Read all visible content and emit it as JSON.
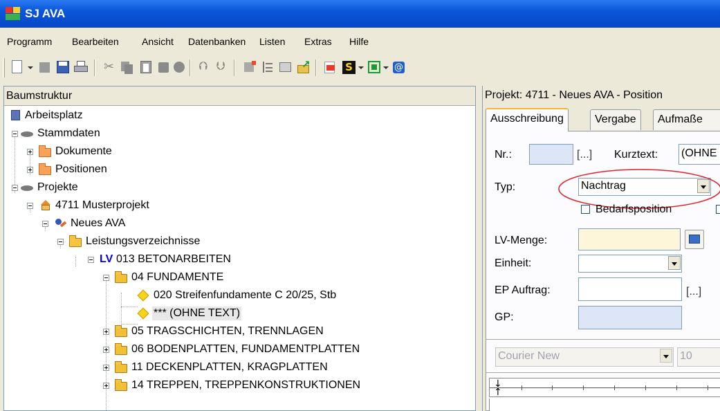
{
  "window": {
    "title": "SJ AVA"
  },
  "menu": [
    "Programm",
    "Bearbeiten",
    "Ansicht",
    "Datenbanken",
    "Listen",
    "Extras",
    "Hilfe"
  ],
  "left_pane": {
    "header": "Baumstruktur",
    "tree": {
      "arbeitsplatz": "Arbeitsplatz",
      "stammdaten": "Stammdaten",
      "dokumente": "Dokumente",
      "positionen": "Positionen",
      "projekte": "Projekte",
      "musterprojekt": "4711 Musterprojekt",
      "neues_ava": "Neues AVA",
      "lv_verzeichnisse": "Leistungsverzeichnisse",
      "lv_tag": "LV",
      "lv_013": "013 BETONARBEITEN",
      "f04": "04 FUNDAMENTE",
      "p020": "020 Streifenfundamente C 20/25, Stb",
      "ohne_text": "*** (OHNE TEXT)",
      "f05": "05 TRAGSCHICHTEN, TRENNLAGEN",
      "f06": "06 BODENPLATTEN, FUNDAMENTPLATTEN",
      "f11": "11 DECKENPLATTEN, KRAGPLATTEN",
      "f14": "14 TREPPEN, TREPPENKONSTRUKTIONEN"
    }
  },
  "right_pane": {
    "header": "Projekt: 4711 - Neues AVA - Position",
    "tabs": [
      "Ausschreibung",
      "Vergabe",
      "Aufmaße"
    ],
    "form": {
      "nr_label": "Nr.:",
      "nr_button": "[...]",
      "kurztext_label": "Kurztext:",
      "kurztext_value": "(OHNE",
      "typ_label": "Typ:",
      "typ_value": "Nachtrag",
      "bedarfsposition_label": "Bedarfsposition",
      "lvmenge_label": "LV-Menge:",
      "einheit_label": "Einheit:",
      "ep_label": "EP Auftrag:",
      "ep_button": "[...]",
      "gp_label": "GP:",
      "font_name": "Courier New",
      "font_size": "10"
    }
  },
  "colors": {
    "title_bar": "#0a55d8",
    "highlight_ellipse": "#e0202a",
    "lv_tag": "#0000ee"
  }
}
